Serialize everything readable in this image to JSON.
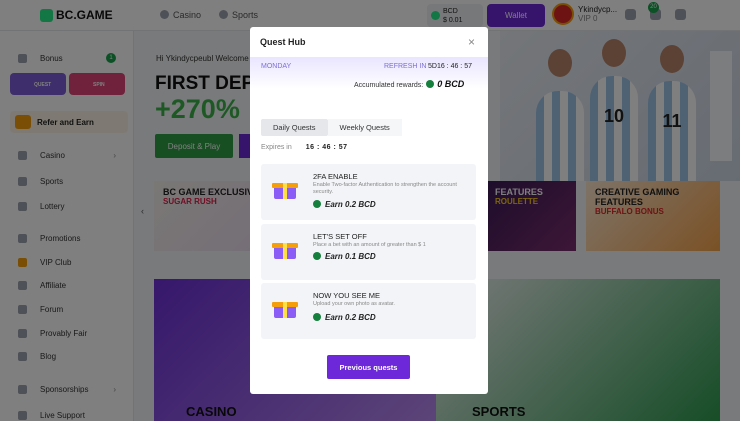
{
  "topbar": {
    "brand": "BC.GAME",
    "nav": [
      "Casino",
      "Sports"
    ],
    "balance_currency": "BCD",
    "balance_amount": "$ 0.01",
    "wallet_label": "Wallet",
    "username": "Ykindycp...",
    "vip": "VIP 0",
    "notification_count": "20"
  },
  "sidebar": {
    "bonus": "Bonus",
    "bonus_badge": "1",
    "mini_quest": "QUEST",
    "mini_spin": "SPIN",
    "refer": "Refer and Earn",
    "items": [
      "Casino",
      "Sports",
      "Lottery",
      "Promotions",
      "VIP Club",
      "Affiliate",
      "Forum",
      "Provably Fair",
      "Blog",
      "Sponsorships",
      "Live Support"
    ]
  },
  "main": {
    "welcome": "Hi Ykindycpeubl Welcome a",
    "first_deposit": "FIRST DEPO",
    "percent": "+270%",
    "deposit_button": "Deposit & Play",
    "promos": [
      {
        "title": "BC GAME EXCLUSIVE",
        "sub": "SUGAR RUSH"
      },
      {
        "title": "FEATURES",
        "sub": "ROULETTE"
      },
      {
        "title": "CREATIVE GAMING FEATURES",
        "sub": "BUFFALO BONUS"
      }
    ],
    "casino": "CASINO",
    "sports": "SPORTS",
    "jerseys": [
      "10",
      "11"
    ]
  },
  "modal": {
    "title": "Quest Hub",
    "day": "MONDAY",
    "refresh_label": "REFRESH IN",
    "refresh_value": "5D16 : 46 : 57",
    "accumulated_label": "Accumulated rewards:",
    "accumulated_value": "0 BCD",
    "tabs": [
      "Daily Quests",
      "Weekly Quests"
    ],
    "expires_label": "Expires in",
    "expires_value": "16 : 46 : 57",
    "quests": [
      {
        "title": "2FA ENABLE",
        "desc": "Enable Two-factor Authentication to strengthen the account security.",
        "reward": "Earn 0.2 BCD"
      },
      {
        "title": "LET'S SET OFF",
        "desc": "Place a bet with an amount of greater than $ 1",
        "reward": "Earn 0.1 BCD"
      },
      {
        "title": "NOW YOU SEE ME",
        "desc": "Upload your own photo as avatar.",
        "reward": "Earn 0.2 BCD"
      }
    ],
    "previous_button": "Previous quests"
  },
  "colors": {
    "accent": "#6d28d9",
    "brand_green": "#24ee89",
    "coin": "#15803d"
  }
}
